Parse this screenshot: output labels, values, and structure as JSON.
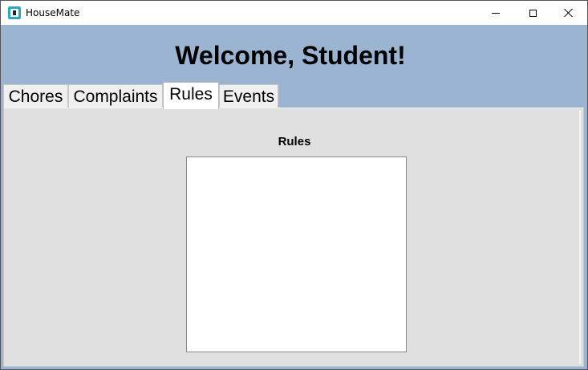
{
  "window": {
    "title": "HouseMate",
    "icon": "housemate-app-icon",
    "controls": [
      "minimize-icon",
      "maximize-icon",
      "close-icon"
    ]
  },
  "header": {
    "welcome": "Welcome, Student!",
    "background_color": "#9bb4d2"
  },
  "tabs": [
    {
      "label": "Chores",
      "selected": false
    },
    {
      "label": "Complaints",
      "selected": false
    },
    {
      "label": "Rules",
      "selected": true
    },
    {
      "label": "Events",
      "selected": false
    }
  ],
  "rules_panel": {
    "title": "Rules",
    "content": ""
  }
}
